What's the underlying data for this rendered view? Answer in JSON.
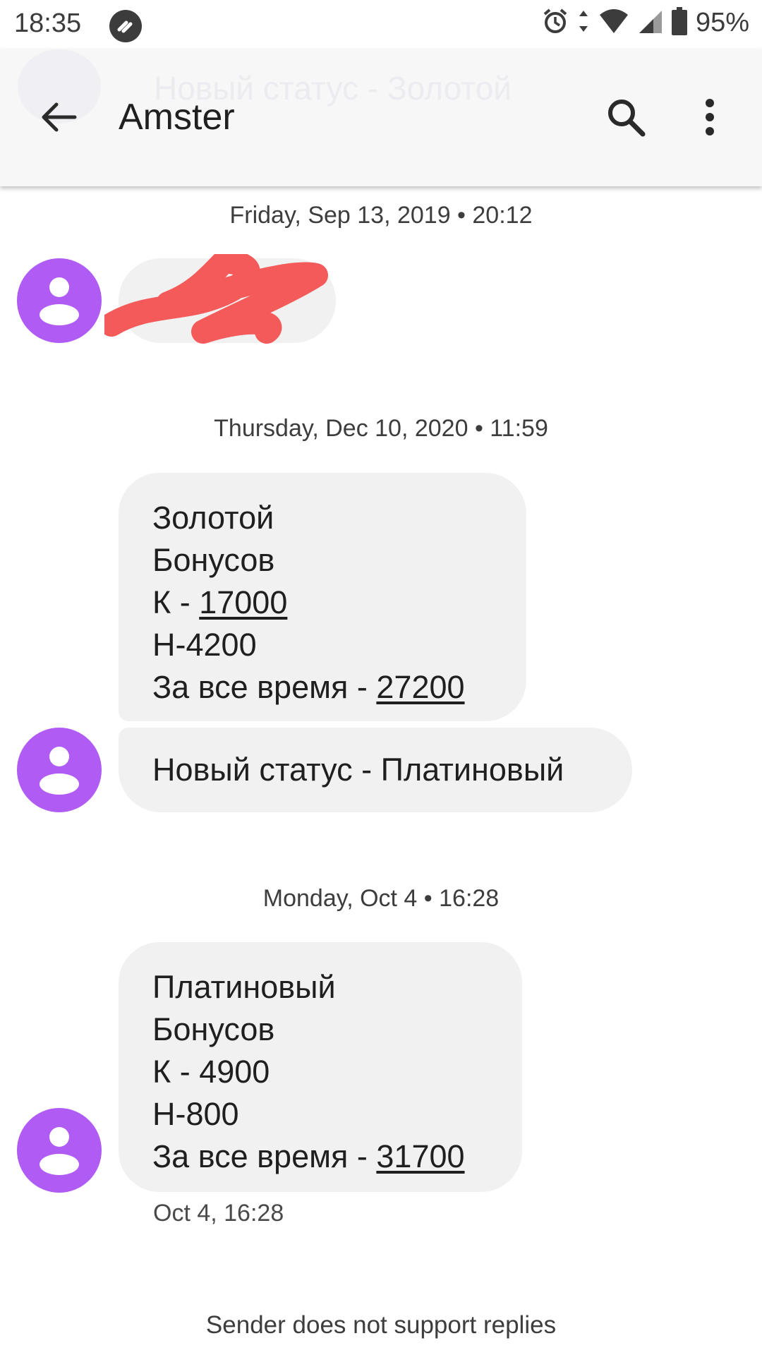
{
  "status_bar": {
    "time": "18:35",
    "battery": "95%",
    "icons": [
      "vpn-key-icon",
      "alarm-icon",
      "data-arrows-icon",
      "wifi-icon",
      "signal-icon",
      "battery-icon"
    ]
  },
  "app_bar": {
    "title": "Amster",
    "ghost_text": "Новый статус - Золотой",
    "icons": [
      "back-arrow-icon",
      "search-icon",
      "more-vert-icon"
    ]
  },
  "colors": {
    "avatar": "#b05cf4",
    "bubble": "#f1f1f1",
    "redaction": "#f45a5a",
    "app_bar": "#f7f7f7"
  },
  "conversation": [
    {
      "date": "Friday, Sep 13, 2019 • 20:12"
    },
    {
      "date": "Thursday, Dec 10, 2020 • 11:59"
    },
    {
      "date": "Monday, Oct 4 • 16:28"
    }
  ],
  "messages": {
    "m2": {
      "line1": "Золотой",
      "line2": "Бонусов",
      "line3_prefix": "К - ",
      "line3_value": "17000",
      "line4": "Н-4200",
      "line5_prefix": "За все время - ",
      "line5_value": "27200"
    },
    "m3": {
      "text": "Новый статус - Платиновый"
    },
    "m4": {
      "line1": "Платиновый",
      "line2": "Бонусов",
      "line3": "К - 4900",
      "line4": "Н-800",
      "line5_prefix": "За все время - ",
      "line5_value": "31700",
      "timestamp": "Oct 4, 16:28"
    }
  },
  "footer": {
    "note": "Sender does not support replies"
  }
}
